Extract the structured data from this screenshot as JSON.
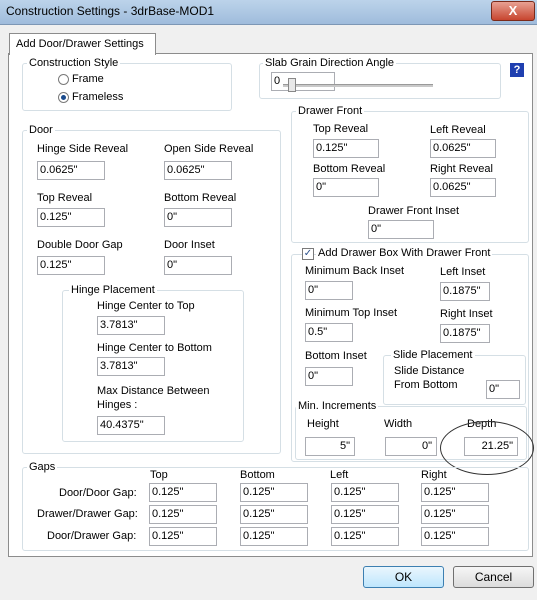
{
  "window": {
    "title": "Construction Settings - 3drBase-MOD1",
    "close": "X"
  },
  "tab": "Add Door/Drawer Settings",
  "construction_style": {
    "label": "Construction Style",
    "option_frame": "Frame",
    "option_frameless": "Frameless",
    "selected": "Frameless"
  },
  "slab_grain": {
    "label": "Slab Grain Direction Angle",
    "value": "0"
  },
  "help_icon": "?",
  "door": {
    "label": "Door",
    "hinge_side_reveal": {
      "label": "Hinge Side Reveal",
      "value": "0.0625\""
    },
    "open_side_reveal": {
      "label": "Open Side Reveal",
      "value": "0.0625\""
    },
    "top_reveal": {
      "label": "Top Reveal",
      "value": "0.125\""
    },
    "bottom_reveal": {
      "label": "Bottom Reveal",
      "value": "0\""
    },
    "double_door_gap": {
      "label": "Double Door Gap",
      "value": "0.125\""
    },
    "door_inset": {
      "label": "Door Inset",
      "value": "0\""
    }
  },
  "hinge_placement": {
    "label": "Hinge Placement",
    "center_to_top": {
      "label": "Hinge Center to Top",
      "value": "3.7813\""
    },
    "center_to_bottom": {
      "label": "Hinge Center to Bottom",
      "value": "3.7813\""
    },
    "max_distance": {
      "label_line1": "Max Distance Between",
      "label_line2": "Hinges :",
      "value": "40.4375\""
    }
  },
  "drawer_front": {
    "label": "Drawer Front",
    "top_reveal": {
      "label": "Top Reveal",
      "value": "0.125\""
    },
    "left_reveal": {
      "label": "Left Reveal",
      "value": "0.0625\""
    },
    "bottom_reveal": {
      "label": "Bottom Reveal",
      "value": "0\""
    },
    "right_reveal": {
      "label": "Right Reveal",
      "value": "0.0625\""
    },
    "inset": {
      "label": "Drawer Front Inset",
      "value": "0\""
    }
  },
  "drawer_box": {
    "checkbox_label": "Add Drawer Box With Drawer Front",
    "checked": true,
    "check_glyph": "✓",
    "min_back_inset": {
      "label": "Minimum Back Inset",
      "value": "0\""
    },
    "left_inset": {
      "label": "Left Inset",
      "value": "0.1875\""
    },
    "min_top_inset": {
      "label": "Minimum Top Inset",
      "value": "0.5\""
    },
    "right_inset": {
      "label": "Right Inset",
      "value": "0.1875\""
    },
    "bottom_inset": {
      "label": "Bottom Inset",
      "value": "0\""
    },
    "slide_placement": {
      "label": "Slide Placement",
      "dist_line1": "Slide Distance",
      "dist_line2": "From Bottom",
      "value": "0\""
    },
    "min_increments": {
      "label": "Min. Increments",
      "height": {
        "label": "Height",
        "value": "5\""
      },
      "width": {
        "label": "Width",
        "value": "0\""
      },
      "depth": {
        "label": "Depth",
        "value": "21.25\""
      }
    }
  },
  "gaps": {
    "label": "Gaps",
    "columns": [
      "Top",
      "Bottom",
      "Left",
      "Right"
    ],
    "rows": [
      {
        "label": "Door/Door Gap:",
        "values": [
          "0.125\"",
          "0.125\"",
          "0.125\"",
          "0.125\""
        ]
      },
      {
        "label": "Drawer/Drawer Gap:",
        "values": [
          "0.125\"",
          "0.125\"",
          "0.125\"",
          "0.125\""
        ]
      },
      {
        "label": "Door/Drawer Gap:",
        "values": [
          "0.125\"",
          "0.125\"",
          "0.125\"",
          "0.125\""
        ]
      }
    ]
  },
  "buttons": {
    "ok": "OK",
    "cancel": "Cancel"
  }
}
